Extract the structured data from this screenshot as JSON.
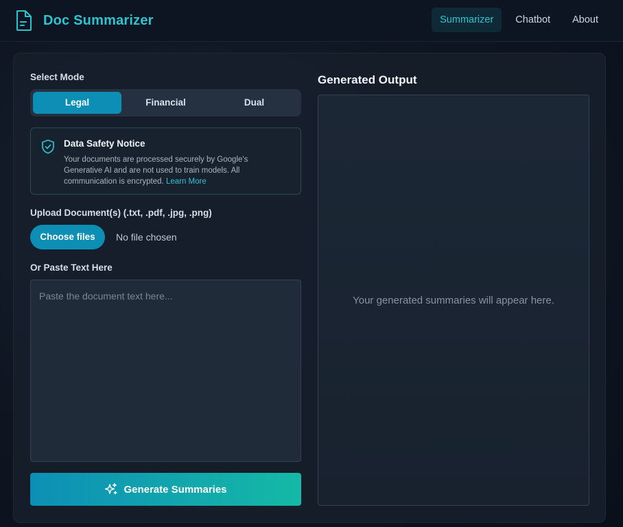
{
  "header": {
    "title": "Doc Summarizer",
    "nav": [
      {
        "label": "Summarizer",
        "active": true
      },
      {
        "label": "Chatbot",
        "active": false
      },
      {
        "label": "About",
        "active": false
      }
    ]
  },
  "mode": {
    "label": "Select Mode",
    "options": [
      "Legal",
      "Financial",
      "Dual"
    ],
    "selected": "Legal"
  },
  "notice": {
    "title": "Data Safety Notice",
    "text": "Your documents are processed securely by Google's Generative AI and are not used to train models. All communication is encrypted.",
    "link": "Learn More"
  },
  "upload": {
    "label": "Upload Document(s) (.txt, .pdf, .jpg, .png)",
    "button": "Choose files",
    "status": "No file chosen"
  },
  "paste": {
    "label": "Or Paste Text Here",
    "placeholder": "Paste the document text here...",
    "value": ""
  },
  "generate": {
    "label": "Generate Summaries"
  },
  "output": {
    "title": "Generated Output",
    "placeholder": "Your generated summaries will appear here."
  },
  "colors": {
    "accent": "#2cc5cf",
    "button": "#0d8fb5",
    "gradient_end": "#15b9a6"
  },
  "icons": {
    "brand": "document-icon",
    "notice": "shield-check-icon",
    "generate": "sparkles-icon"
  }
}
